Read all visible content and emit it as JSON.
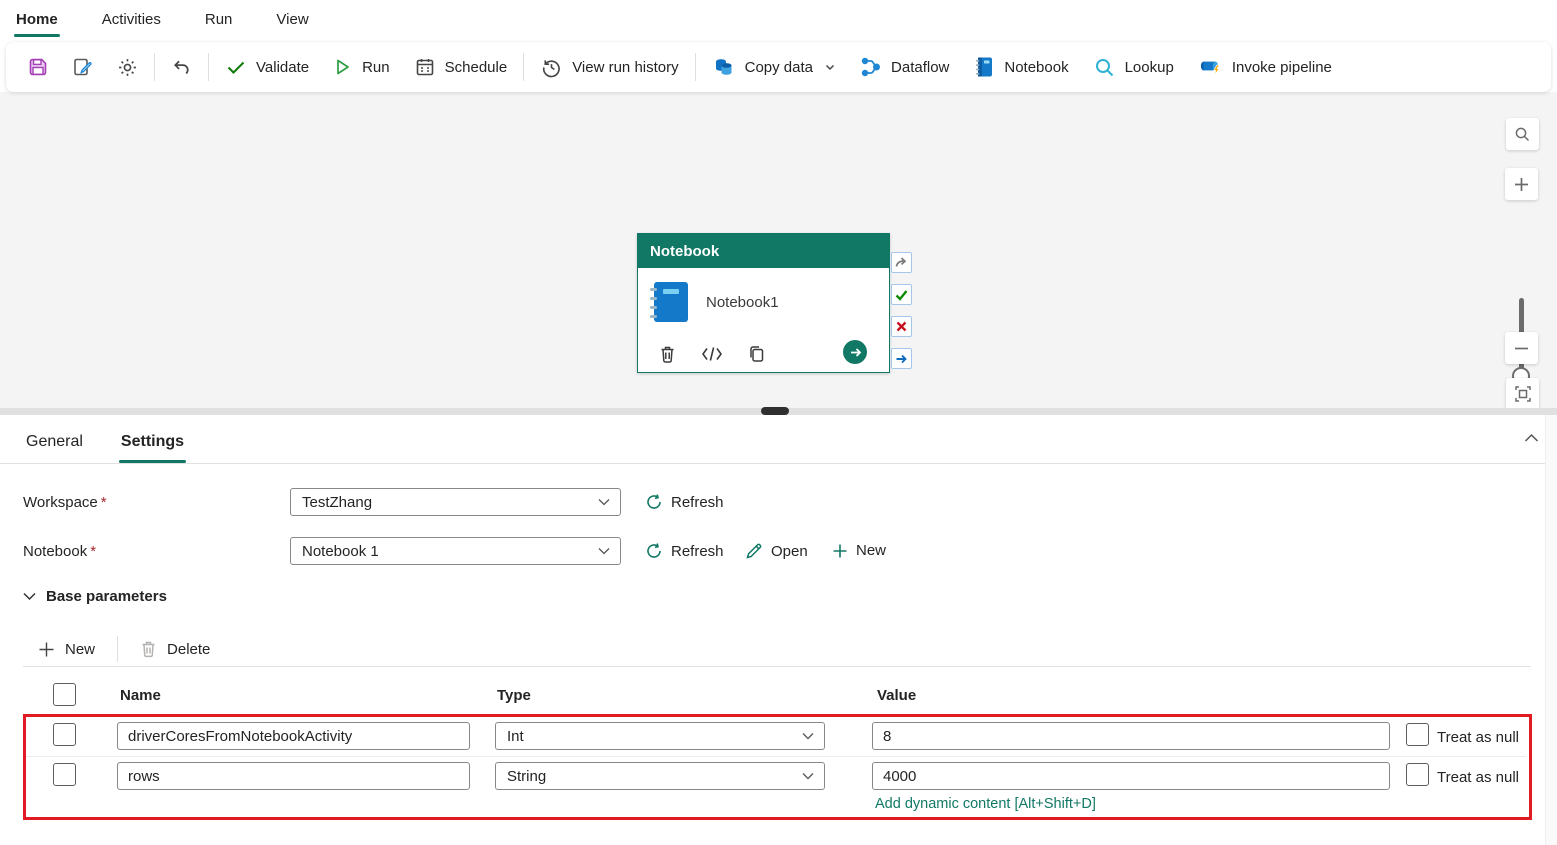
{
  "colors": {
    "accent_teal": "#117865",
    "annotation_red": "#e01b24",
    "icon_blue": "#0f6cbd",
    "validate_green": "#107c10",
    "save_purple": "#a33eb5",
    "fail_red": "#c50f1f",
    "lookup_cyan": "#2fb1d4",
    "bolt_orange": "#f7a800"
  },
  "menu": {
    "tabs": [
      {
        "label": "Home",
        "active": true
      },
      {
        "label": "Activities",
        "active": false
      },
      {
        "label": "Run",
        "active": false
      },
      {
        "label": "View",
        "active": false
      }
    ]
  },
  "toolbar": {
    "validate": "Validate",
    "run": "Run",
    "schedule": "Schedule",
    "view_run_history": "View run history",
    "copy_data": "Copy data",
    "dataflow": "Dataflow",
    "notebook": "Notebook",
    "lookup": "Lookup",
    "invoke_pipeline": "Invoke pipeline"
  },
  "canvas": {
    "activity": {
      "type_label": "Notebook",
      "name": "Notebook1"
    }
  },
  "panel": {
    "tabs": [
      {
        "label": "General",
        "active": false
      },
      {
        "label": "Settings",
        "active": true
      }
    ],
    "workspace": {
      "label": "Workspace",
      "required_mark": "*",
      "value": "TestZhang",
      "refresh_label": "Refresh"
    },
    "notebook": {
      "label": "Notebook",
      "required_mark": "*",
      "value": "Notebook 1",
      "refresh_label": "Refresh",
      "open_label": "Open",
      "new_label": "New"
    },
    "base_parameters": {
      "title": "Base parameters",
      "new_label": "New",
      "delete_label": "Delete",
      "columns": {
        "name": "Name",
        "type": "Type",
        "value": "Value"
      },
      "rows": [
        {
          "name": "driverCoresFromNotebookActivity",
          "type": "Int",
          "value": "8",
          "treat_as_null_label": "Treat as null"
        },
        {
          "name": "rows",
          "type": "String",
          "value": "4000",
          "treat_as_null_label": "Treat as null",
          "dynamic_content_label": "Add dynamic content [Alt+Shift+D]"
        }
      ]
    }
  }
}
